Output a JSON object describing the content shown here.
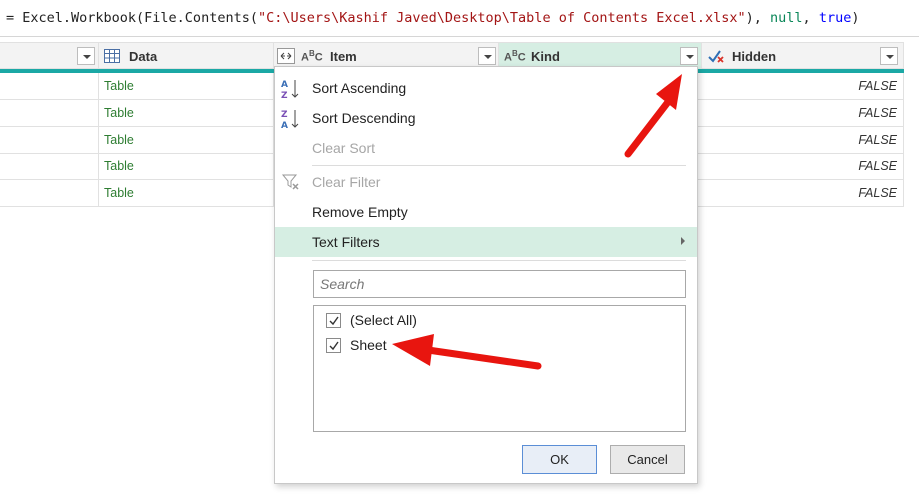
{
  "formula": {
    "prefix": "= Excel.Workbook(File.Contents(",
    "path": "\"C:\\Users\\Kashif Javed\\Desktop\\Table of Contents Excel.xlsx\"",
    "mid1": "), ",
    "null_kw": "null",
    "mid2": ", ",
    "true_kw": "true",
    "suffix": ")"
  },
  "columns": {
    "data": "Data",
    "item": "Item",
    "kind": "Kind",
    "hidden": "Hidden"
  },
  "rows": [
    {
      "data": "Table",
      "hidden": "FALSE"
    },
    {
      "data": "Table",
      "hidden": "FALSE"
    },
    {
      "data": "Table",
      "hidden": "FALSE"
    },
    {
      "data": "Table",
      "hidden": "FALSE"
    },
    {
      "data": "Table",
      "hidden": "FALSE"
    }
  ],
  "menu": {
    "sort_asc": "Sort Ascending",
    "sort_desc": "Sort Descending",
    "clear_sort": "Clear Sort",
    "clear_filter": "Clear Filter",
    "remove_empty": "Remove Empty",
    "text_filters": "Text Filters"
  },
  "search": {
    "placeholder": "Search"
  },
  "list": [
    {
      "label": "(Select All)",
      "checked": true
    },
    {
      "label": "Sheet",
      "checked": true
    }
  ],
  "buttons": {
    "ok": "OK",
    "cancel": "Cancel"
  },
  "colors": {
    "accent_teal": "#1ba8a5",
    "highlight": "#d6eee3",
    "arrow_red": "#e8150f"
  }
}
